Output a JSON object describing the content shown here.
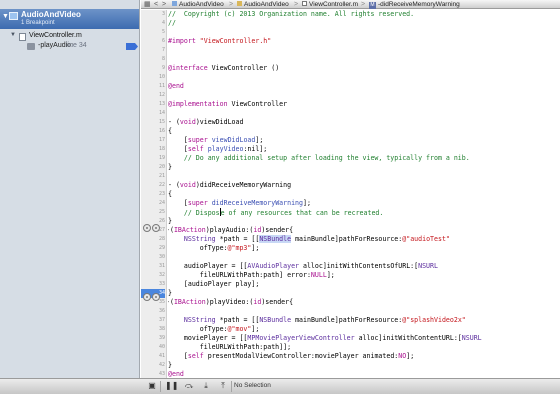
{
  "navigator": {
    "project_name": "AudioAndVideo",
    "project_subtitle": "1 Breakpoint",
    "file_name": "ViewController.m",
    "breakpoint_name": "-playAudio:",
    "breakpoint_line": "line 34"
  },
  "jumpbar": {
    "crumb1": "AudioAndVideo",
    "crumb2": "AudioAndVideo",
    "crumb3": "ViewController.m",
    "crumb4": "-didReceiveMemoryWarning",
    "crumb4_icon": "M",
    "separator": ">",
    "back_icon": "<",
    "forward_icon": ">",
    "related_icon": "grid-icon"
  },
  "gutter": {
    "current_line": "34",
    "lines": [
      "3",
      "4",
      "5",
      "6",
      "7",
      "8",
      "9",
      "10",
      "11",
      "12",
      "13",
      "14",
      "15",
      "16",
      "17",
      "18",
      "19",
      "20",
      "21",
      "22",
      "23",
      "24",
      "25",
      "26",
      "27",
      "28",
      "29",
      "30",
      "31",
      "32",
      "33",
      "34",
      "35",
      "36",
      "37",
      "38",
      "39",
      "40",
      "41",
      "42",
      "43",
      "44"
    ]
  },
  "code": {
    "l3": "//  Copyright (c) 2013 Organization name. All rights reserved.",
    "l4": "//",
    "l6_kw": "#import",
    "l6_str": "\"ViewController.h\"",
    "l8_kw": "@interface",
    "l8_rest": " ViewController ()",
    "l10": "@end",
    "l12_kw": "@implementation",
    "l12_rest": " ViewController",
    "l14_a": "- (",
    "l14_kw": "void",
    "l14_b": ")viewDidLoad",
    "l15": "{",
    "l16_a": "    [",
    "l16_kw": "super",
    "l16_fn": " viewDidLoad",
    "l16_b": "];",
    "l17_a": "    [",
    "l17_kw": "self",
    "l17_fn": " playVideo",
    "l17_b": ":nil];",
    "l18": "    // Do any additional setup after loading the view, typically from a nib.",
    "l19": "}",
    "l21_a": "- (",
    "l21_kw": "void",
    "l21_b": ")didReceiveMemoryWarning",
    "l22": "{",
    "l23_a": "    [",
    "l23_kw": "super",
    "l23_fn": " didReceiveMemoryWarning",
    "l23_b": "];",
    "l24_a": "    // Dispos",
    "l24_b": "e of any resources that can be recreated.",
    "l25": "}",
    "l26_a": "-(",
    "l26_kw": "IBAction",
    "l26_b": ")playAudio:(",
    "l26_kw2": "id",
    "l26_c": ")sender{",
    "l27_a": "    ",
    "l27_ty": "NSString",
    "l27_b": " *path = [[",
    "l27_ty2": "NSBundle",
    "l27_c": " mainBundle]pathForResource:",
    "l27_st": "@\"audioTest\"",
    "l28_a": "        ofType:",
    "l28_st": "@\"mp3\"",
    "l28_b": "];",
    "l30_a": "    audioPlayer = [[",
    "l30_ty": "AVAudioPlayer",
    "l30_b": " alloc]initWithContentsOfURL:[",
    "l30_ty2": "NSURL",
    "l31_a": "        fileURLWithPath:path] error:",
    "l31_kw": "NULL",
    "l31_b": "];",
    "l32": "    [audioPlayer play];",
    "l33": "}",
    "l34_a": "-(",
    "l34_kw": "IBAction",
    "l34_b": ")playVideo:(",
    "l34_kw2": "id",
    "l34_c": ")sender{",
    "l36_a": "    ",
    "l36_ty": "NSString",
    "l36_b": " *path = [[",
    "l36_ty2": "NSBundle",
    "l36_c": " mainBundle]pathForResource:",
    "l36_st": "@\"splashVideo2x\"",
    "l37_a": "        ofType:",
    "l37_st": "@\"mov\"",
    "l37_b": "];",
    "l38_a": "    moviePlayer = [[",
    "l38_ty": "MPMoviePlayerViewController",
    "l38_b": " alloc]initWithContentURL:[",
    "l38_ty2": "NSURL",
    "l39": "        fileURLWithPath:path]];",
    "l40_a": "    [",
    "l40_kw": "self",
    "l40_b": " presentModalViewController:moviePlayer animated:",
    "l40_kw2": "NO",
    "l40_c": "];",
    "l41": "}",
    "l42": "@end"
  },
  "bottombar": {
    "status": "No Selection",
    "icons": [
      "show-debug-area-icon",
      "pause-icon",
      "step-over-icon",
      "step-in-icon",
      "step-out-icon",
      "location-icon"
    ]
  },
  "colors": {
    "keyword": "#a9108f",
    "comment": "#1f7f2e",
    "string": "#c4161c",
    "type": "#5b2d9e",
    "selection": "#4a86de"
  }
}
